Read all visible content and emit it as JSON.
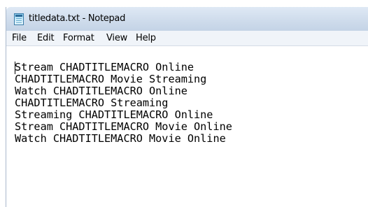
{
  "window": {
    "title": "titledata.txt - Notepad",
    "app_icon": "notepad-icon"
  },
  "menubar": {
    "items": [
      "File",
      "Edit",
      "Format",
      "View",
      "Help"
    ]
  },
  "editor": {
    "lines": [
      "Stream CHADTITLEMACRO Online",
      "CHADTITLEMACRO Movie Streaming",
      "Watch CHADTITLEMACRO Online",
      "CHADTITLEMACRO Streaming",
      "Streaming CHADTITLEMACRO Online",
      "Stream CHADTITLEMACRO Movie Online",
      "Watch CHADTITLEMACRO Movie Online"
    ]
  }
}
